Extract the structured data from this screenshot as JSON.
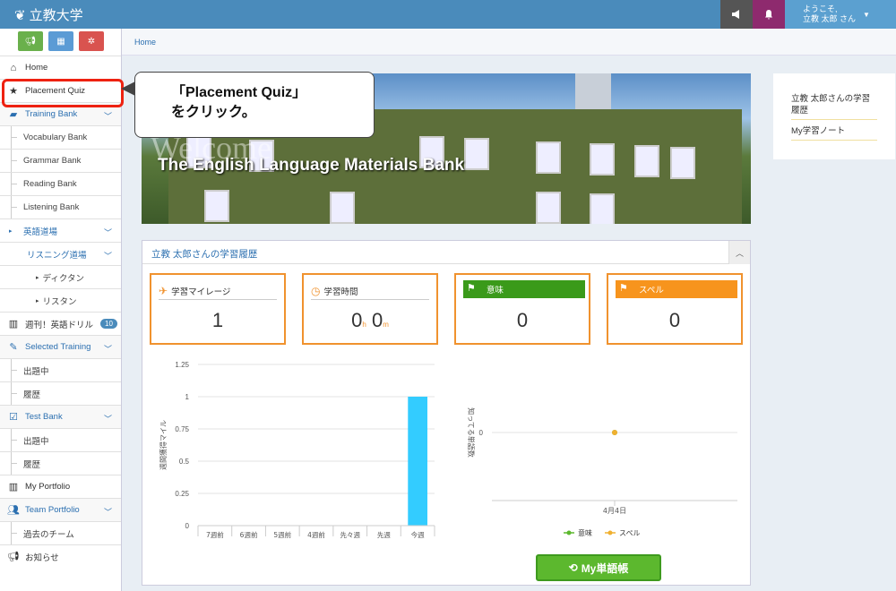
{
  "header": {
    "brand": "立教大学",
    "user_greeting": "ようこそ,",
    "user_name": "立教 太郎 さん"
  },
  "sidebar": {
    "items": [
      {
        "label": "Home"
      },
      {
        "label": "Placement Quiz"
      },
      {
        "label": "Training Bank"
      },
      {
        "label": "Vocabulary Bank"
      },
      {
        "label": "Grammar Bank"
      },
      {
        "label": "Reading Bank"
      },
      {
        "label": "Listening Bank"
      },
      {
        "label": "英語道場"
      },
      {
        "label": "リスニング道場"
      },
      {
        "label": "ディクタン"
      },
      {
        "label": "リスタン"
      },
      {
        "label": "週刊！英語ドリル",
        "badge": "10"
      },
      {
        "label": "Selected Training"
      },
      {
        "label": "出題中"
      },
      {
        "label": "履歴"
      },
      {
        "label": "Test Bank"
      },
      {
        "label": "出題中"
      },
      {
        "label": "履歴"
      },
      {
        "label": "My Portfolio"
      },
      {
        "label": "Team Portfolio"
      },
      {
        "label": "過去のチーム"
      },
      {
        "label": "お知らせ"
      }
    ]
  },
  "breadcrumb": "Home",
  "banner": {
    "welcome": "Welcome",
    "subtitle": "The English Language Materials Bank"
  },
  "right_panel": {
    "links": [
      "立教 太郎さんの学習履歴",
      "My学習ノート"
    ]
  },
  "callout": {
    "line1": "「Placement Quiz」",
    "line2": "をクリック。"
  },
  "history": {
    "title": "立教 太郎さんの学習履歴",
    "cards": [
      {
        "label": "学習マイレージ",
        "value": "1"
      },
      {
        "label": "学習時間",
        "hours": "0",
        "h_unit": "h",
        "minutes": "0",
        "m_unit": "m"
      },
      {
        "label": "意味",
        "value": "0",
        "color": "#3a9a1a"
      },
      {
        "label": "スペル",
        "value": "0",
        "color": "#f7941d"
      }
    ]
  },
  "chart_data": [
    {
      "type": "bar",
      "ylabel": "週間獲得マイル",
      "categories": [
        "7週前",
        "6週前",
        "5週前",
        "4週前",
        "先々週",
        "先週",
        "今週"
      ],
      "values": [
        0,
        0,
        0,
        0,
        0,
        0,
        1
      ],
      "ylim": [
        0,
        1.25
      ],
      "yticks": [
        "0",
        "0.25",
        "0.5",
        "0.75",
        "1",
        "1.25"
      ],
      "grid": true,
      "color": "#33ccff"
    },
    {
      "type": "line",
      "ylabel": "知ってる単語数",
      "x": [
        "4月4日"
      ],
      "yticks": [
        "0"
      ],
      "series": [
        {
          "name": "意味",
          "values": [
            0
          ],
          "color": "#5cb82e"
        },
        {
          "name": "スペル",
          "values": [
            0
          ],
          "color": "#f0b030"
        }
      ],
      "legend": "bottom"
    }
  ],
  "button": {
    "my_vocab": "My単語帳"
  }
}
